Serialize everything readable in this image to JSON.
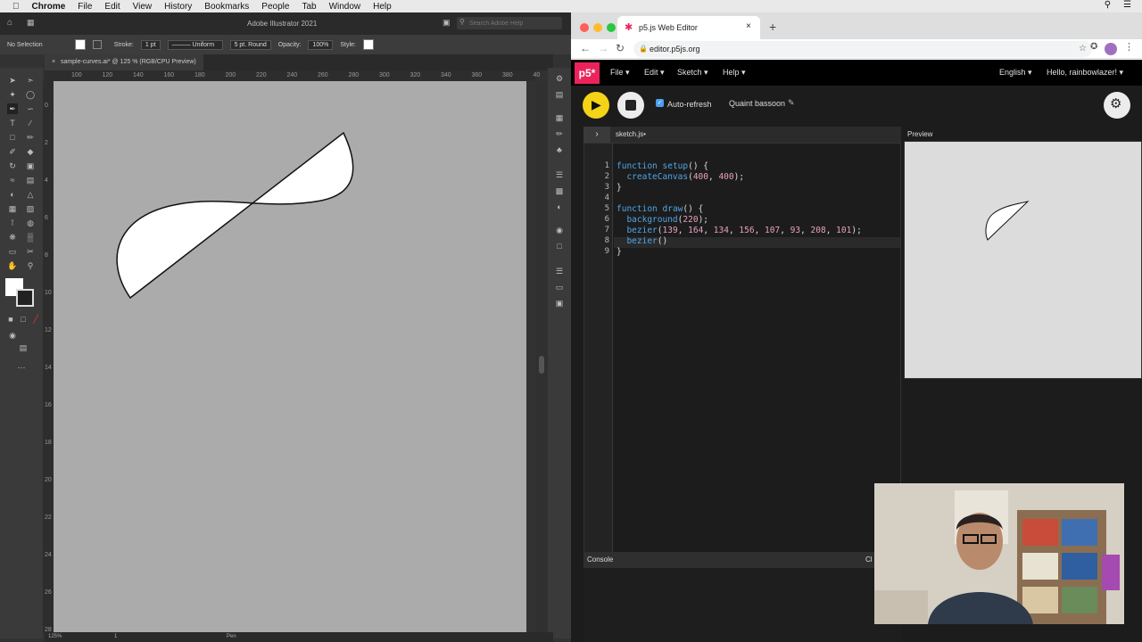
{
  "menubar": {
    "app": "Chrome",
    "items": [
      "File",
      "Edit",
      "View",
      "History",
      "Bookmarks",
      "People",
      "Tab",
      "Window",
      "Help"
    ]
  },
  "illustrator": {
    "title": "Adobe Illustrator 2021",
    "search_placeholder": "Search Adobe Help",
    "control": {
      "selection": "No Selection",
      "stroke_label": "Stroke:",
      "stroke_value": "1 pt",
      "profile": "Uniform",
      "brush": "5 pt. Round",
      "opacity_label": "Opacity:",
      "opacity_value": "100%",
      "style_label": "Style:"
    },
    "document_tab": "sample-curves.ai* @ 125 % (RGB/CPU Preview)",
    "ruler_h": [
      "100",
      "120",
      "140",
      "160",
      "180",
      "200",
      "220",
      "240",
      "260",
      "280",
      "300",
      "320",
      "340",
      "360",
      "380",
      "40"
    ],
    "ruler_v": [
      "0",
      "2",
      "4",
      "6",
      "8",
      "10",
      "12",
      "14",
      "16",
      "18",
      "20",
      "22",
      "24",
      "26",
      "28"
    ],
    "status": {
      "zoom": "125%",
      "artboard": "1",
      "tool": "Pen"
    }
  },
  "chrome": {
    "tab_title": "p5.js Web Editor",
    "url": "editor.p5js.org"
  },
  "p5": {
    "logo": "p5*",
    "nav": {
      "file": "File",
      "edit": "Edit",
      "sketch": "Sketch",
      "help": "Help",
      "language": "English",
      "user": "Hello, rainbowlazer!"
    },
    "auto_refresh": "Auto-refresh",
    "sketch_name": "Quaint bassoon",
    "file_tab": "sketch.js",
    "preview_label": "Preview",
    "console_label": "Console",
    "console_clear": "Cl",
    "code_lines": [
      "function setup() {",
      "  createCanvas(400, 400);",
      "}",
      "",
      "function draw() {",
      "  background(220);",
      "  bezier(139, 164, 134, 156, 107, 93, 208, 101);",
      "  bezier()",
      "}"
    ],
    "line_numbers": [
      "1",
      "2",
      "3",
      "4",
      "5",
      "6",
      "7",
      "8",
      "9"
    ]
  },
  "colors": {
    "p5_pink": "#ed225d",
    "p5_yellow": "#f5d316",
    "canvas_gray": "#ababab"
  }
}
